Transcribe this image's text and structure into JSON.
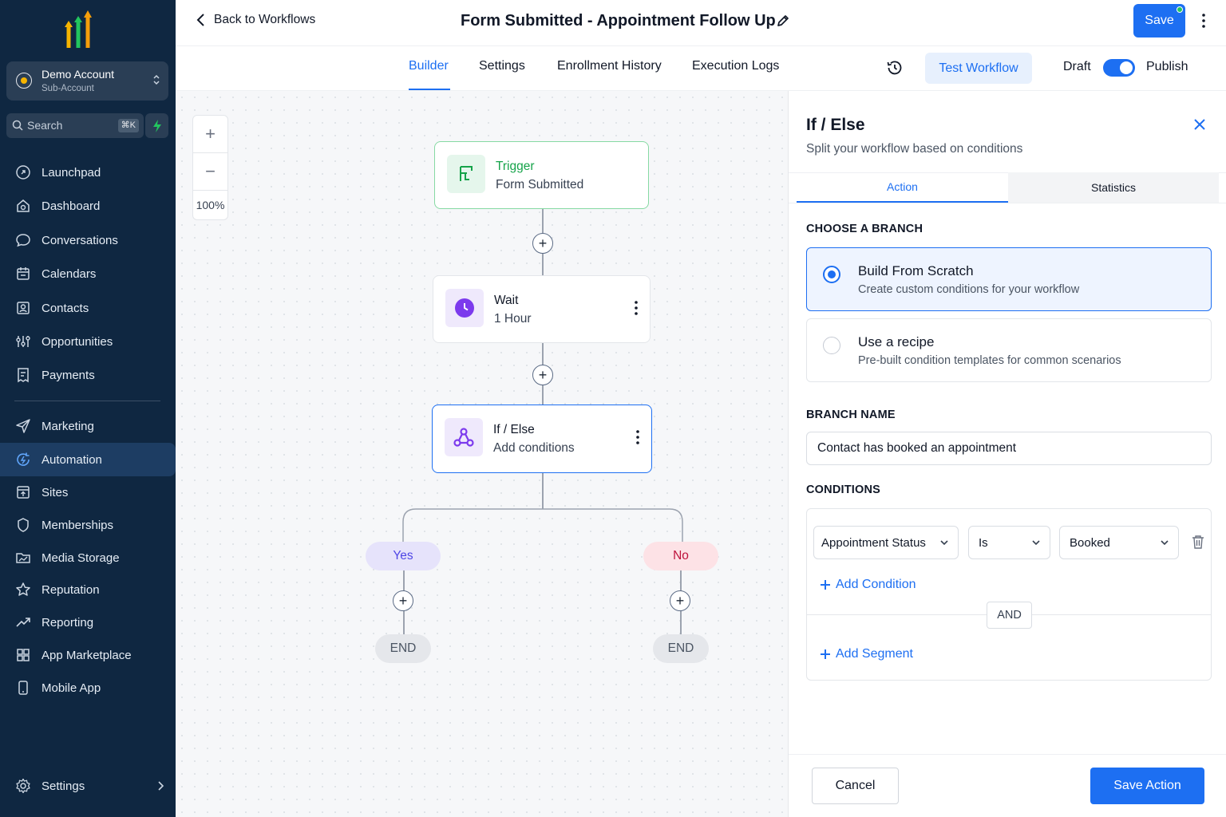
{
  "sidebar": {
    "account": {
      "name": "Demo Account",
      "subtitle": "Sub-Account"
    },
    "search": {
      "placeholder": "Search",
      "shortcut": "⌘K"
    },
    "items": [
      {
        "label": "Launchpad",
        "icon": "rocket-icon"
      },
      {
        "label": "Dashboard",
        "icon": "dashboard-icon"
      },
      {
        "label": "Conversations",
        "icon": "chat-icon"
      },
      {
        "label": "Calendars",
        "icon": "calendar-icon"
      },
      {
        "label": "Contacts",
        "icon": "contacts-icon"
      },
      {
        "label": "Opportunities",
        "icon": "opportunities-icon"
      },
      {
        "label": "Payments",
        "icon": "payments-icon"
      },
      {
        "label": "Marketing",
        "icon": "send-icon"
      },
      {
        "label": "Automation",
        "icon": "automation-icon",
        "active": true
      },
      {
        "label": "Sites",
        "icon": "sites-icon"
      },
      {
        "label": "Memberships",
        "icon": "memberships-icon"
      },
      {
        "label": "Media Storage",
        "icon": "media-storage-icon"
      },
      {
        "label": "Reputation",
        "icon": "star-icon"
      },
      {
        "label": "Reporting",
        "icon": "trend-icon"
      },
      {
        "label": "App Marketplace",
        "icon": "grid-icon"
      },
      {
        "label": "Mobile App",
        "icon": "mobile-icon"
      }
    ],
    "settings": {
      "label": "Settings",
      "icon": "gear-icon"
    }
  },
  "header": {
    "back_label": "Back to Workflows",
    "title": "Form Submitted - Appointment Follow Up",
    "save_label": "Save"
  },
  "tabs": {
    "items": [
      "Builder",
      "Settings",
      "Enrollment History",
      "Execution Logs"
    ],
    "active": "Builder",
    "test_workflow": "Test Workflow",
    "draft": "Draft",
    "publish": "Publish",
    "published": true
  },
  "canvas": {
    "zoom": "100%",
    "trigger": {
      "title": "Trigger",
      "subtitle": "Form Submitted"
    },
    "wait": {
      "title": "Wait",
      "subtitle": "1 Hour"
    },
    "ifelse": {
      "title": "If / Else",
      "subtitle": "Add conditions"
    },
    "yes_label": "Yes",
    "no_label": "No",
    "end_label": "END"
  },
  "panel": {
    "title": "If / Else",
    "subtitle": "Split your workflow based on conditions",
    "tabs": {
      "action": "Action",
      "statistics": "Statistics"
    },
    "choose_branch": "CHOOSE A BRANCH",
    "options": [
      {
        "title": "Build From Scratch",
        "desc": "Create custom conditions for your workflow",
        "selected": true
      },
      {
        "title": "Use a recipe",
        "desc": "Pre-built condition templates for common scenarios",
        "selected": false
      }
    ],
    "branch_name_label": "BRANCH NAME",
    "branch_name_value": "Contact has booked an appointment",
    "conditions_label": "CONDITIONS",
    "condition": {
      "field": "Appointment Status",
      "operator": "Is",
      "value": "Booked"
    },
    "add_condition": "Add Condition",
    "and_label": "AND",
    "add_segment": "Add Segment",
    "cancel": "Cancel",
    "save_action": "Save Action"
  },
  "colors": {
    "sidebar_bg": "#0f2741",
    "accent": "#1d6ff2",
    "trigger_green": "#16a34a",
    "wait_purple": "#7c3aed",
    "yes_bg": "#e6e3fb",
    "no_bg": "#fde2e6"
  }
}
